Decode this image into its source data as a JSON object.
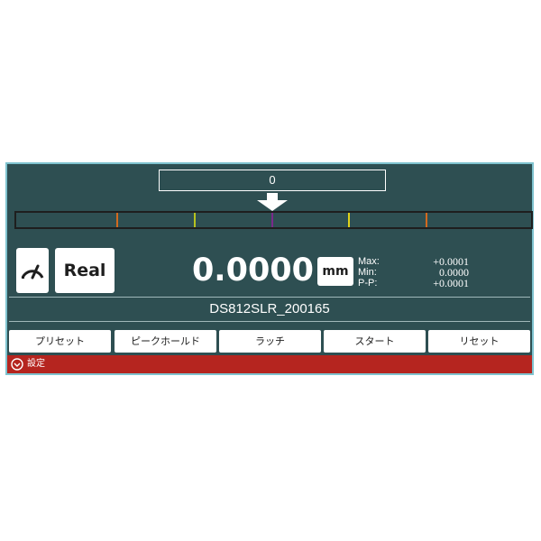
{
  "display": {
    "deviation_value": "0",
    "main_value": "0.0000",
    "unit_label": "mm",
    "mode_label": "Real",
    "gauge_icon": "gauge-icon"
  },
  "scale": {
    "pointer_icon": "down-arrow-icon",
    "tick_colors": [
      "#d2691e",
      "#b7c21f",
      "#7a2a8a",
      "#e0d21a",
      "#d2691e"
    ]
  },
  "stats": {
    "max_label": "Max:",
    "min_label": "Min:",
    "pp_label": "P-P:",
    "max_value": "+0.0001",
    "min_value": "0.0000",
    "pp_value": "+0.0001"
  },
  "device": {
    "name": "DS812SLR_200165"
  },
  "buttons": {
    "preset": "プリセット",
    "peak_hold": "ピークホールド",
    "latch": "ラッチ",
    "start": "スタート",
    "reset": "リセット"
  },
  "settings": {
    "label": "設定",
    "icon": "chevron-down-circle-icon"
  },
  "colors": {
    "panel": "#2e4f52",
    "border": "#7fc3cf",
    "settings_bar": "#b5251f"
  }
}
